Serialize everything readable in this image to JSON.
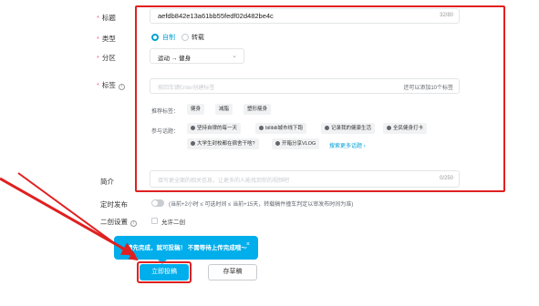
{
  "form": {
    "title": {
      "label": "标题",
      "value": "aefdb842e13a61bb55fedf02d482be4c",
      "counter": "32/80"
    },
    "type": {
      "label": "类型",
      "options": [
        "自制",
        "转载"
      ],
      "selected": "自制"
    },
    "zone": {
      "label": "分区",
      "value": "运动 → 健身"
    },
    "tags": {
      "label": "标签",
      "placeholder": "按回车键Enter创建标签",
      "hint": "还可以添加10个标签",
      "recommended_label": "推荐标签：",
      "recommended": [
        "健身",
        "减脂",
        "塑形瘦身"
      ],
      "topics_label": "参与话题：",
      "topics": [
        "坚持自律的每一天",
        "bilibili城市线下跑",
        "记录我的健康生活",
        "全民健身打卡",
        "大学生封校都在宿舍干啥?",
        "开箱分享VLOG"
      ],
      "more_topics": "搜索更多话题 ›"
    },
    "intro": {
      "label": "简介",
      "placeholder": "填写更全面的相关信息，让更多的人能找到你的视频吧",
      "counter": "0/250"
    },
    "schedule": {
      "label": "定时发布",
      "hint": "(当前+2小时 ≤ 可选时间 ≤ 当前+15天，转载稿件撞车判定以审发布时间为准)"
    },
    "second_creation": {
      "label": "二创设置",
      "checkbox": "允许二创"
    },
    "hidden_label": "",
    "tooltip": {
      "text": "请先完成，就可投稿！ 不需等待上传完成哦～",
      "close": "×"
    },
    "buttons": {
      "submit": "立即投稿",
      "draft": "存草稿"
    }
  },
  "colors": {
    "accent": "#00aeec",
    "required": "#f25d8e",
    "annotation": "#e02020"
  }
}
